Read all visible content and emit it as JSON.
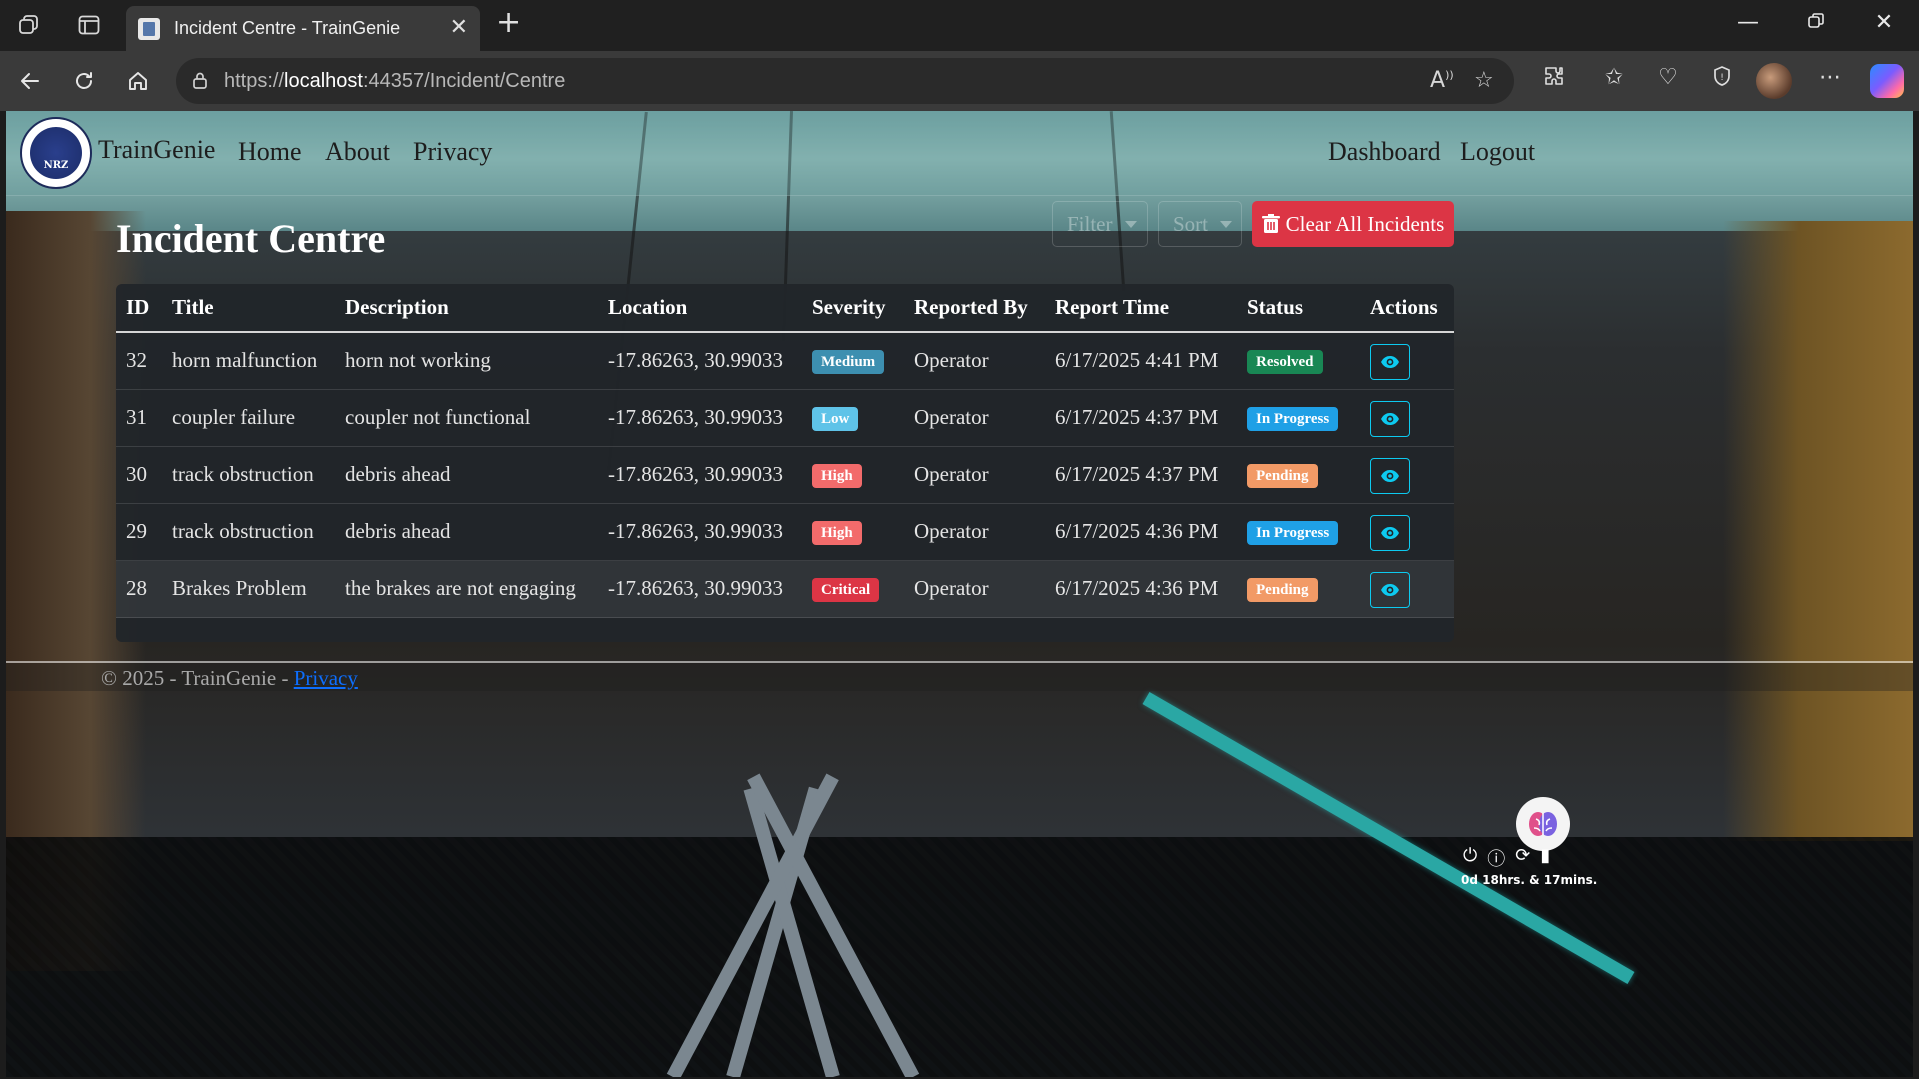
{
  "browser": {
    "tab_title": "Incident Centre - TrainGenie",
    "url_prefix": "https://",
    "url_host": "localhost",
    "url_rest": ":44357/Incident/Centre"
  },
  "navbar": {
    "logo_text": "NRZ",
    "brand": "TrainGenie",
    "links": {
      "home": "Home",
      "about": "About",
      "privacy": "Privacy"
    },
    "right": {
      "dashboard": "Dashboard",
      "logout": "Logout"
    }
  },
  "page": {
    "title": "Incident Centre",
    "filter_label": "Filter",
    "sort_label": "Sort",
    "clear_label": "Clear All Incidents"
  },
  "table": {
    "headers": {
      "id": "ID",
      "title": "Title",
      "description": "Description",
      "location": "Location",
      "severity": "Severity",
      "reported_by": "Reported By",
      "report_time": "Report Time",
      "status": "Status",
      "actions": "Actions"
    },
    "rows": [
      {
        "id": "32",
        "title": "horn malfunction",
        "description": "horn not working",
        "location": "-17.86263, 30.99033",
        "severity": "Medium",
        "reported_by": "Operator",
        "report_time": "6/17/2025 4:41 PM",
        "status": "Resolved"
      },
      {
        "id": "31",
        "title": "coupler failure",
        "description": "coupler not functional",
        "location": "-17.86263, 30.99033",
        "severity": "Low",
        "reported_by": "Operator",
        "report_time": "6/17/2025 4:37 PM",
        "status": "In Progress"
      },
      {
        "id": "30",
        "title": "track obstruction",
        "description": "debris ahead",
        "location": "-17.86263, 30.99033",
        "severity": "High",
        "reported_by": "Operator",
        "report_time": "6/17/2025 4:37 PM",
        "status": "Pending"
      },
      {
        "id": "29",
        "title": "track obstruction",
        "description": "debris ahead",
        "location": "-17.86263, 30.99033",
        "severity": "High",
        "reported_by": "Operator",
        "report_time": "6/17/2025 4:36 PM",
        "status": "In Progress"
      },
      {
        "id": "28",
        "title": "Brakes Problem",
        "description": "the brakes are not engaging",
        "location": "-17.86263, 30.99033",
        "severity": "Critical",
        "reported_by": "Operator",
        "report_time": "6/17/2025 4:36 PM",
        "status": "Pending"
      }
    ]
  },
  "footer": {
    "text": "© 2025 - TrainGenie - ",
    "link": "Privacy"
  },
  "tray": {
    "uptime": "0d 18hrs. & 17mins."
  },
  "colors": {
    "danger": "#dc3545",
    "info_outline": "#0dcaf0",
    "sev_medium": "#3d8fb0",
    "sev_low": "#5fc3e8",
    "sev_high": "#f26b6b",
    "sev_critical": "#dc3545",
    "st_resolved": "#198754",
    "st_inprogress": "#1fa0e6",
    "st_pending": "#f29a66"
  },
  "icons": [
    "workspaces-icon",
    "tab-actions-icon",
    "page-icon",
    "close-icon",
    "plus-icon",
    "minimize-icon",
    "restore-icon",
    "back-icon",
    "refresh-icon",
    "home-icon",
    "lock-icon",
    "read-aloud-icon",
    "star-icon",
    "extensions-icon",
    "favorites-icon",
    "health-icon",
    "shield-icon",
    "more-icon",
    "copilot-icon",
    "trash-icon",
    "eye-icon",
    "brain-icon",
    "power-icon",
    "info-icon",
    "sync-icon",
    "battery-icon"
  ]
}
